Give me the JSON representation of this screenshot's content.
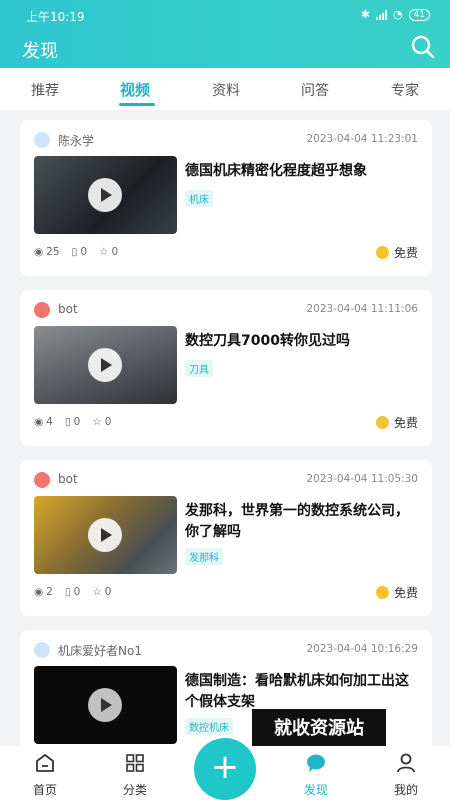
{
  "status": {
    "time": "上午10:19",
    "battery": "41"
  },
  "header": {
    "title": "发现"
  },
  "tabs": [
    "推荐",
    "视频",
    "资料",
    "问答",
    "专家"
  ],
  "active_tab": 1,
  "cards": [
    {
      "author": "陈永学",
      "date": "2023-04-04 11:23:01",
      "title": "德国机床精密化程度超乎想象",
      "tag": "机床",
      "views": "25",
      "docs": "0",
      "stars": "0",
      "price": "免费"
    },
    {
      "author": "bot",
      "date": "2023-04-04 11:11:06",
      "title": "数控刀具7000转你见过吗",
      "tag": "刀具",
      "views": "4",
      "docs": "0",
      "stars": "0",
      "price": "免费"
    },
    {
      "author": "bot",
      "date": "2023-04-04 11:05:30",
      "title": "发那科，世界第一的数控系统公司，你了解吗",
      "tag": "发那科",
      "views": "2",
      "docs": "0",
      "stars": "0",
      "price": "免费"
    },
    {
      "author": "机床爱好者No1",
      "date": "2023-04-04 10:16:29",
      "title": "德国制造：看哈默机床如何加工出这个假体支架",
      "tag": "数控机床"
    }
  ],
  "watermark": "就收资源站",
  "tabbar": {
    "home": "首页",
    "category": "分类",
    "discover": "发现",
    "mine": "我的",
    "add": "+"
  },
  "colors": {
    "accent": "#1eb5c7",
    "header": "#2fc6cf",
    "coin": "#f6c32f"
  }
}
